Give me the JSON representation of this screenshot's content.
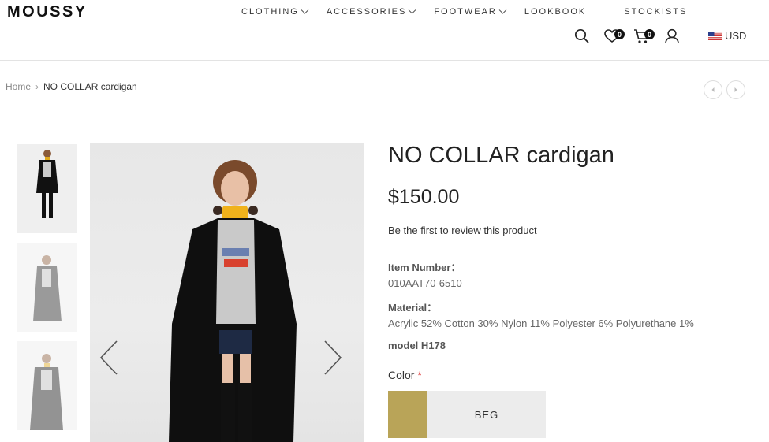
{
  "brand": "MOUSSY",
  "nav": {
    "items": [
      {
        "label": "CLOTHING",
        "dropdown": true
      },
      {
        "label": "ACCESSORIES",
        "dropdown": true
      },
      {
        "label": "FOOTWEAR",
        "dropdown": true
      },
      {
        "label": "LOOKBOOK",
        "dropdown": false
      },
      {
        "label": "STOCKISTS",
        "dropdown": false
      }
    ]
  },
  "header": {
    "wishlist_count": "0",
    "cart_count": "0",
    "currency": "USD",
    "icons": [
      "search-icon",
      "heart-icon",
      "cart-icon",
      "user-icon",
      "us-flag-icon"
    ]
  },
  "breadcrumb": {
    "home": "Home",
    "current": "NO COLLAR cardigan"
  },
  "product": {
    "title": "NO COLLAR cardigan",
    "price": "$150.00",
    "review_link": "Be the first to review this product",
    "item_number_label": "Item Number：",
    "item_number": "010AAT70-6510",
    "material_label": "Material：",
    "material": "Acrylic 52% Cotton 30% Nylon 11% Polyester 6% Polyurethane 1%",
    "model": "model H178",
    "color_label": "Color",
    "required_mark": "*",
    "color_option": "BEG",
    "color_hex": "#b9a458"
  },
  "colors": {
    "accent": "#111111",
    "required": "#dd3333"
  }
}
